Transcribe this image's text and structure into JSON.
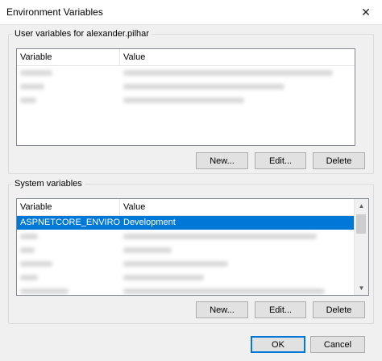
{
  "window": {
    "title": "Environment Variables"
  },
  "user_vars": {
    "group_label": "User variables for alexander.pilhar",
    "columns": [
      "Variable",
      "Value"
    ],
    "buttons": {
      "new": "New...",
      "edit": "Edit...",
      "delete": "Delete"
    }
  },
  "system_vars": {
    "group_label": "System variables",
    "columns": [
      "Variable",
      "Value"
    ],
    "rows": [
      {
        "variable": "ASPNETCORE_ENVIRONMENT",
        "value": "Development",
        "selected": true
      }
    ],
    "buttons": {
      "new": "New...",
      "edit": "Edit...",
      "delete": "Delete"
    }
  },
  "dialog_buttons": {
    "ok": "OK",
    "cancel": "Cancel"
  },
  "icons": {
    "close": "close-icon",
    "scroll_up": "chevron-up-icon",
    "scroll_down": "chevron-down-icon"
  },
  "colors": {
    "selection": "#0078d7",
    "default_button_border": "#0078d7"
  }
}
